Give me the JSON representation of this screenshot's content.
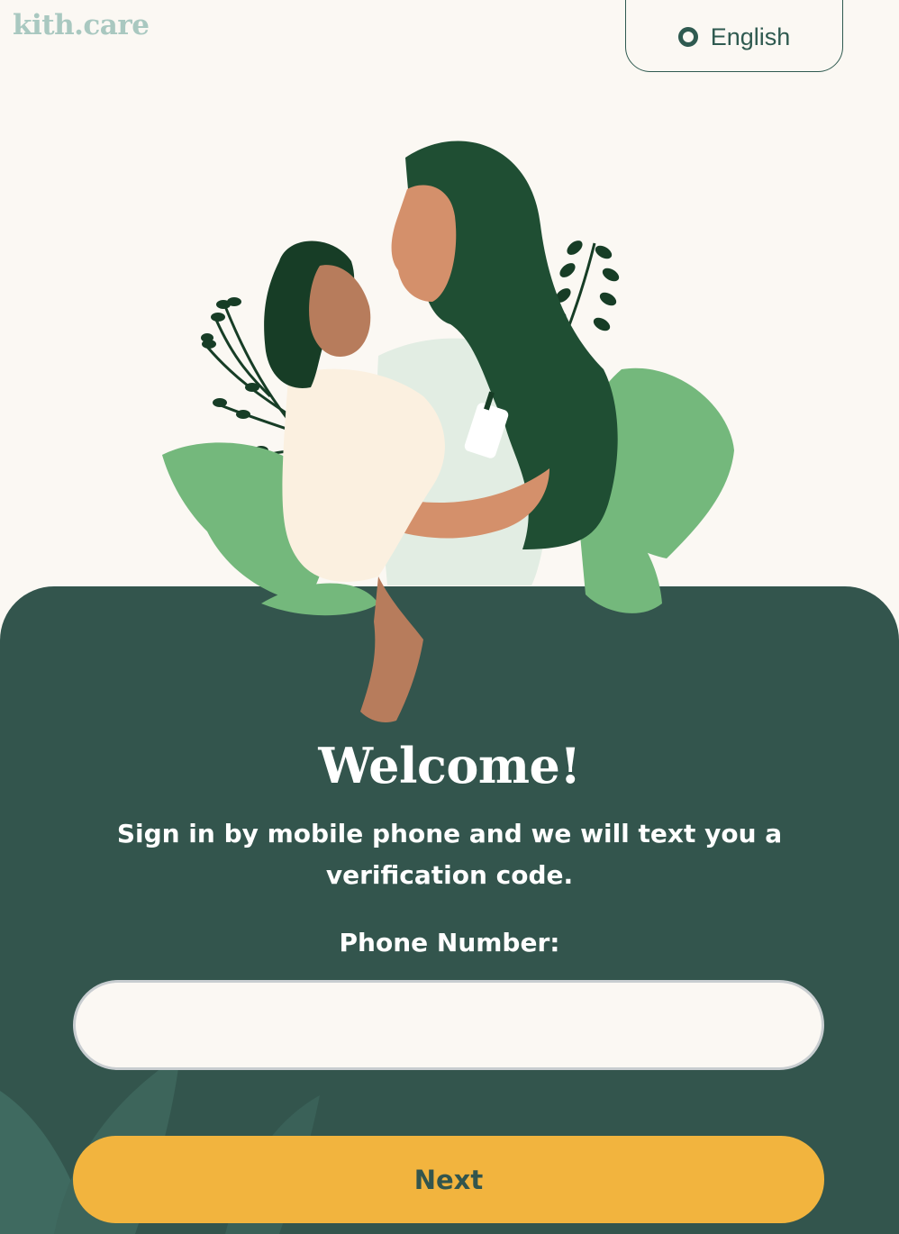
{
  "header": {
    "logo_text": "kith.care",
    "language_label": "English"
  },
  "icons": {
    "language": "radio-ring-icon",
    "illustration": "mother-and-child-illustration"
  },
  "main": {
    "title": "Welcome!",
    "subtitle": "Sign in by mobile phone and we will text you a verification code.",
    "phone_label": "Phone Number:",
    "phone_value": "",
    "phone_placeholder": "",
    "next_label": "Next"
  },
  "colors": {
    "background": "#fbf8f3",
    "panel": "#33554d",
    "accent_button": "#f2b43e",
    "logo": "#a9c8c0",
    "leaf_light": "#74b87c",
    "hair": "#1f4e33"
  }
}
